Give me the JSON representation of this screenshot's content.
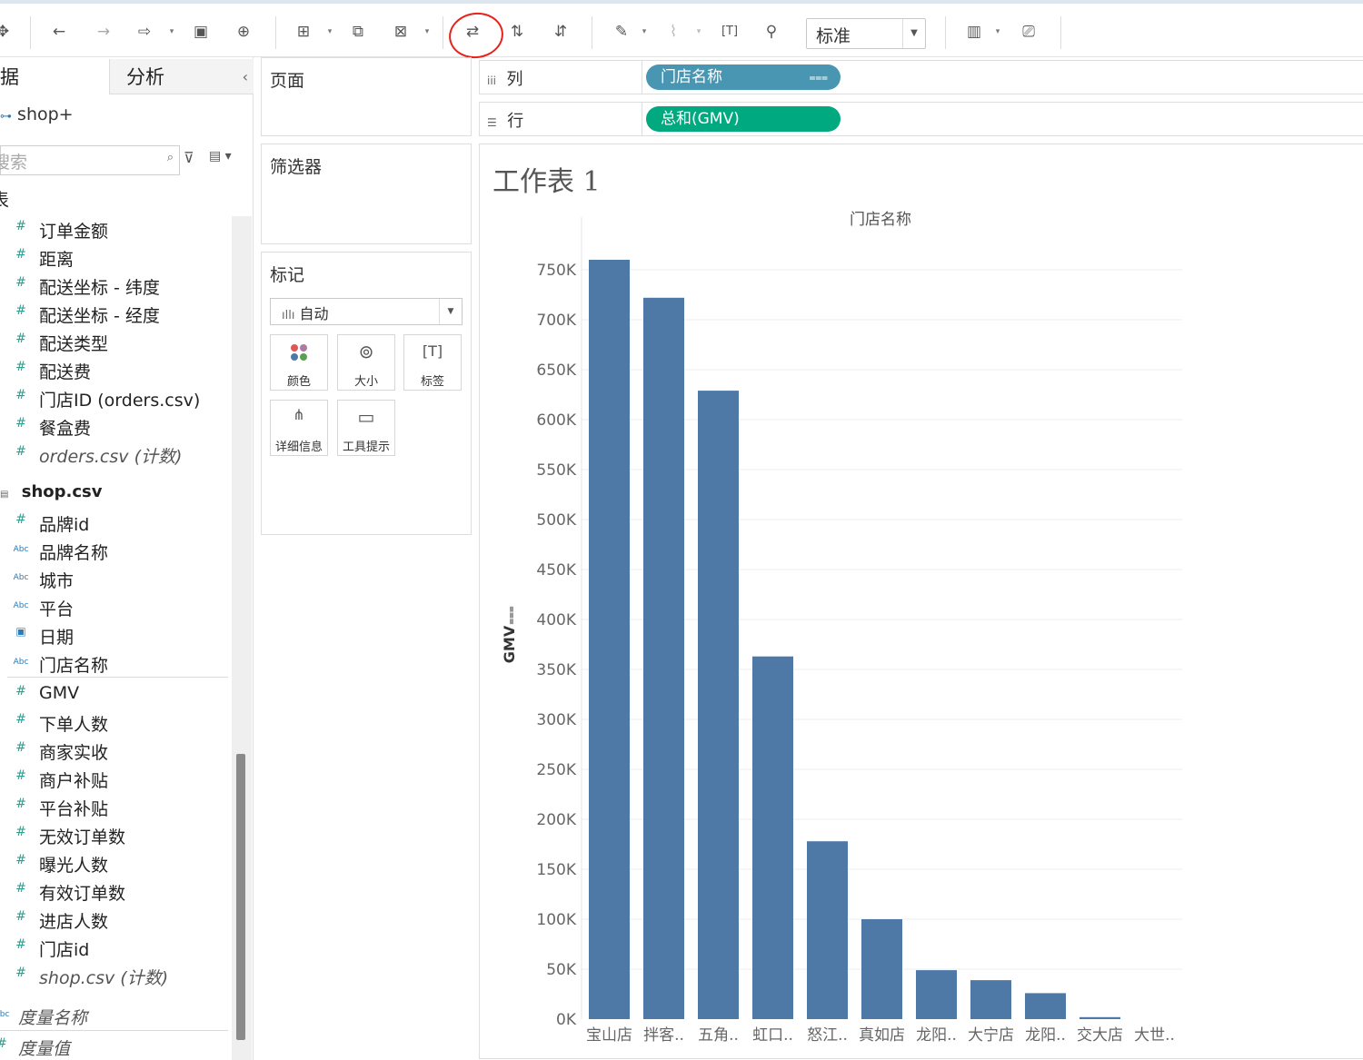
{
  "toolbar": {
    "fit_value": "标准",
    "icons": [
      "move-icon",
      "undo-icon",
      "redo-icon",
      "replay-icon",
      "save-icon",
      "new-datasource-icon",
      "new-worksheet-icon",
      "duplicate-sheet-icon",
      "clear-sheet-icon",
      "swap-rows-columns-icon",
      "sort-ascending-icon",
      "sort-descending-icon",
      "highlight-icon",
      "group-icon",
      "show-labels-icon",
      "pin-icon",
      "show-me-icon",
      "presentation-icon"
    ]
  },
  "datapane": {
    "tab_data": "数据",
    "tab_analytics": "分析",
    "datasource": "shop+",
    "search_placeholder": "搜索",
    "section_label": "表",
    "orders_fields": [
      {
        "name": "订单金额",
        "type": "#"
      },
      {
        "name": "距离",
        "type": "#"
      },
      {
        "name": "配送坐标 - 纬度",
        "type": "#"
      },
      {
        "name": "配送坐标 - 经度",
        "type": "#"
      },
      {
        "name": "配送类型",
        "type": "#"
      },
      {
        "name": "配送费",
        "type": "#"
      },
      {
        "name": "门店ID (orders.csv)",
        "type": "#"
      },
      {
        "name": "餐盒费",
        "type": "#"
      },
      {
        "name": "orders.csv (计数)",
        "type": "#"
      }
    ],
    "shop_table": "shop.csv",
    "shop_dims": [
      {
        "name": "品牌id",
        "type": "#"
      },
      {
        "name": "品牌名称",
        "type": "Abc"
      },
      {
        "name": "城市",
        "type": "Abc"
      },
      {
        "name": "平台",
        "type": "Abc"
      },
      {
        "name": "日期",
        "type": "📅"
      },
      {
        "name": "门店名称",
        "type": "Abc"
      }
    ],
    "shop_measures": [
      {
        "name": "GMV",
        "type": "#"
      },
      {
        "name": "下单人数",
        "type": "#"
      },
      {
        "name": "商家实收",
        "type": "#"
      },
      {
        "name": "商户补贴",
        "type": "#"
      },
      {
        "name": "平台补贴",
        "type": "#"
      },
      {
        "name": "无效订单数",
        "type": "#"
      },
      {
        "name": "曝光人数",
        "type": "#"
      },
      {
        "name": "有效订单数",
        "type": "#"
      },
      {
        "name": "进店人数",
        "type": "#"
      },
      {
        "name": "门店id",
        "type": "#"
      },
      {
        "name": "shop.csv (计数)",
        "type": "#"
      }
    ],
    "measure_names": "度量名称",
    "measure_values": "度量值"
  },
  "cards": {
    "pages": "页面",
    "filters": "筛选器",
    "marks": "标记",
    "mark_type": "自动",
    "mark_buttons": [
      "颜色",
      "大小",
      "标签",
      "详细信息",
      "工具提示"
    ]
  },
  "shelves": {
    "columns_label": "列",
    "columns_pill": "门店名称",
    "rows_label": "行",
    "rows_pill": "总和(GMV)"
  },
  "colors": {
    "columns_pill": "#4996b2",
    "rows_pill": "#00a97f",
    "bar": "#4e79a7"
  },
  "sheet": {
    "title": "工作表 1"
  },
  "chart_data": {
    "type": "bar",
    "title": "门店名称",
    "xlabel": "门店名称",
    "ylabel": "GMV",
    "categories": [
      "宝山店",
      "拌客..",
      "五角..",
      "虹口..",
      "怒江..",
      "真如店",
      "龙阳..",
      "大宁店",
      "龙阳..",
      "交大店",
      "大世.."
    ],
    "values": [
      760000,
      722000,
      629000,
      363000,
      178000,
      100000,
      49000,
      39000,
      26000,
      2000,
      0
    ],
    "ylim": [
      0,
      750000
    ],
    "yticks": [
      "0K",
      "50K",
      "100K",
      "150K",
      "200K",
      "250K",
      "300K",
      "350K",
      "400K",
      "450K",
      "500K",
      "550K",
      "600K",
      "650K",
      "700K",
      "750K"
    ],
    "grid": true
  }
}
